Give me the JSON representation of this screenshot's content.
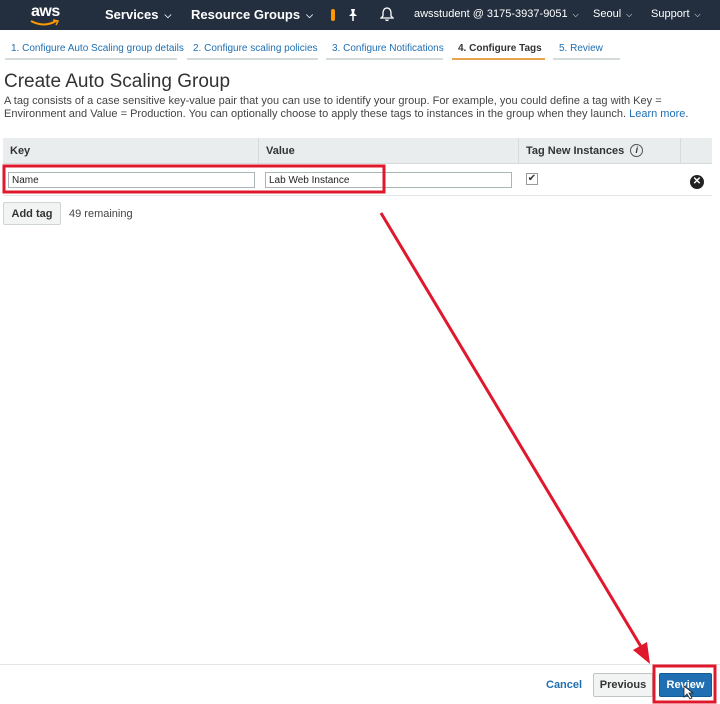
{
  "topnav": {
    "logo_text": "aws",
    "services": "Services",
    "resource_groups": "Resource Groups",
    "account": "awsstudent @ 3175-3937-9051",
    "region": "Seoul",
    "support": "Support",
    "background_color": "#232f3e"
  },
  "wizard_tabs": [
    {
      "label": "1. Configure Auto Scaling group details"
    },
    {
      "label": "2. Configure scaling policies"
    },
    {
      "label": "3. Configure Notifications"
    },
    {
      "label": "4. Configure Tags"
    },
    {
      "label": "5. Review"
    }
  ],
  "page": {
    "title": "Create Auto Scaling Group",
    "description": "A tag consists of a case sensitive key-value pair that you can use to identify your group. For example, you could define a tag with Key = Environment and Value = Production. You can optionally choose to apply these tags to instances in the group when they launch.",
    "learn_more": "Learn more",
    "period": "."
  },
  "table": {
    "headers": {
      "key": "Key",
      "value": "Value",
      "tag_new_instances": "Tag New Instances"
    },
    "rows": [
      {
        "key": "Name",
        "value": "Lab Web Instance",
        "tag_new_instances": "✔"
      }
    ]
  },
  "add_tag": {
    "label": "Add tag",
    "remaining": "49 remaining"
  },
  "footer": {
    "cancel": "Cancel",
    "previous": "Previous",
    "review": "Review"
  },
  "annotation_color": "#e0182d",
  "accent_color": "#1f6fb2"
}
